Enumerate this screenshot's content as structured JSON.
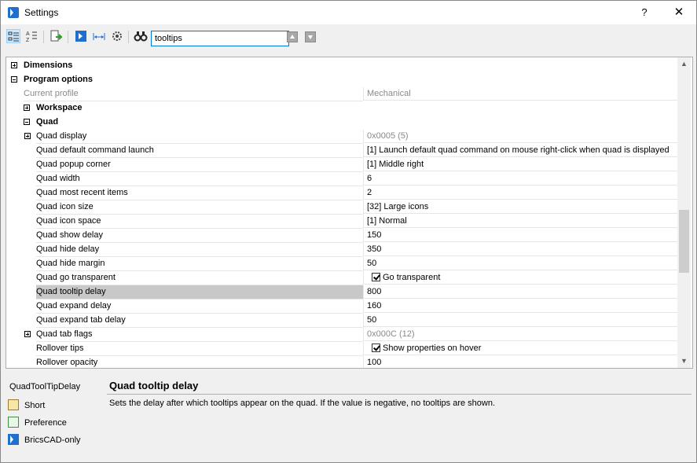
{
  "window": {
    "title": "Settings",
    "help_label": "?",
    "close_label": "✕"
  },
  "toolbar": {
    "search_value": "tooltips",
    "buttons": [
      "categorized-view",
      "alphabetical-view",
      "export",
      "bricscad",
      "dimension",
      "settings-gear",
      "find"
    ]
  },
  "grid": {
    "rows": [
      {
        "type": "cat",
        "name": "Dimensions",
        "expander": "+"
      },
      {
        "type": "cat",
        "name": "Program options",
        "expander": "-"
      },
      {
        "type": "prop",
        "name": "Current profile",
        "value": "Mechanical",
        "grey": true
      },
      {
        "type": "cat",
        "name": "Workspace",
        "expander": "+"
      },
      {
        "type": "cat",
        "name": "Quad",
        "expander": "-"
      },
      {
        "type": "prop",
        "name": "Quad display",
        "value": "0x0005 (5)",
        "grey_value": true,
        "expander": "+"
      },
      {
        "type": "prop",
        "name": "Quad default command launch",
        "value": "[1] Launch default quad command on mouse right-click when quad is displayed"
      },
      {
        "type": "prop",
        "name": "Quad popup corner",
        "value": "[1] Middle right"
      },
      {
        "type": "prop",
        "name": "Quad width",
        "value": "6"
      },
      {
        "type": "prop",
        "name": "Quad most recent items",
        "value": "2"
      },
      {
        "type": "prop",
        "name": "Quad icon size",
        "value": "[32] Large icons"
      },
      {
        "type": "prop",
        "name": "Quad icon space",
        "value": "[1] Normal"
      },
      {
        "type": "prop",
        "name": "Quad show delay",
        "value": "150"
      },
      {
        "type": "prop",
        "name": "Quad hide delay",
        "value": "350"
      },
      {
        "type": "prop",
        "name": "Quad hide margin",
        "value": "50"
      },
      {
        "type": "prop",
        "name": "Quad go transparent",
        "value": "Go transparent",
        "checkbox": true
      },
      {
        "type": "prop",
        "name": "Quad tooltip delay",
        "value": "800",
        "selected": true
      },
      {
        "type": "prop",
        "name": "Quad expand delay",
        "value": "160"
      },
      {
        "type": "prop",
        "name": "Quad expand tab delay",
        "value": "50"
      },
      {
        "type": "prop",
        "name": "Quad tab flags",
        "value": "0x000C (12)",
        "grey_value": true,
        "expander": "+"
      },
      {
        "type": "prop",
        "name": "Rollover tips",
        "value": "Show properties on hover",
        "checkbox": true
      },
      {
        "type": "prop",
        "name": "Rollover opacity",
        "value": "100"
      }
    ]
  },
  "description": {
    "command_name": "QuadToolTipDelay",
    "attributes": [
      {
        "label": "Short",
        "icon": "short-icon"
      },
      {
        "label": "Preference",
        "icon": "preference-icon"
      },
      {
        "label": "BricsCAD-only",
        "icon": "bricscad-icon"
      }
    ],
    "title": "Quad tooltip delay",
    "text": "Sets the delay after which tooltips appear on the quad. If the value is negative, no tooltips are shown."
  }
}
